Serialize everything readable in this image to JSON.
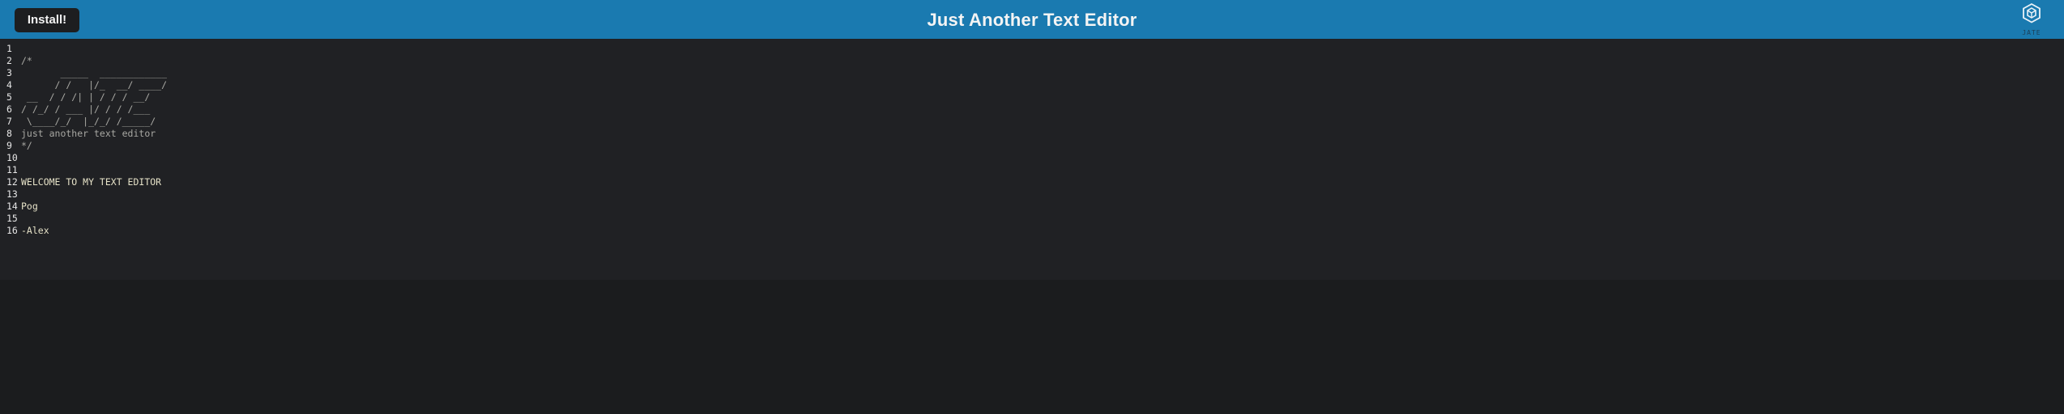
{
  "header": {
    "install_label": "Install!",
    "title": "Just Another Text Editor",
    "logo_icon": "jate-cube-logo-icon",
    "logo_text": "JATE"
  },
  "colors": {
    "header_bg": "#1a7ab0",
    "editor_bg": "#202124",
    "page_bg": "#1b1c1e",
    "comment_text": "#a8a8a3",
    "code_text": "#e6e2c8"
  },
  "editor": {
    "lines": [
      {
        "num": "1",
        "text": "",
        "comment": false
      },
      {
        "num": "2",
        "text": "/*",
        "comment": true
      },
      {
        "num": "3",
        "text": "       _____  ____________",
        "comment": true
      },
      {
        "num": "4",
        "text": "      / /   |/_  __/ ____/",
        "comment": true
      },
      {
        "num": "5",
        "text": " __  / / /| | / / / __/",
        "comment": true
      },
      {
        "num": "6",
        "text": "/ /_/ / ___ |/ / / /___",
        "comment": true
      },
      {
        "num": "7",
        "text": " \\____/_/  |_/_/ /_____/",
        "comment": true
      },
      {
        "num": "8",
        "text": "just another text editor",
        "comment": true
      },
      {
        "num": "9",
        "text": "*/",
        "comment": true
      },
      {
        "num": "10",
        "text": "",
        "comment": false
      },
      {
        "num": "11",
        "text": "",
        "comment": false
      },
      {
        "num": "12",
        "text": "WELCOME TO MY TEXT EDITOR",
        "comment": false
      },
      {
        "num": "13",
        "text": "",
        "comment": false
      },
      {
        "num": "14",
        "text": "Pog",
        "comment": false
      },
      {
        "num": "15",
        "text": "",
        "comment": false
      },
      {
        "num": "16",
        "text": "-Alex",
        "comment": false
      }
    ]
  }
}
